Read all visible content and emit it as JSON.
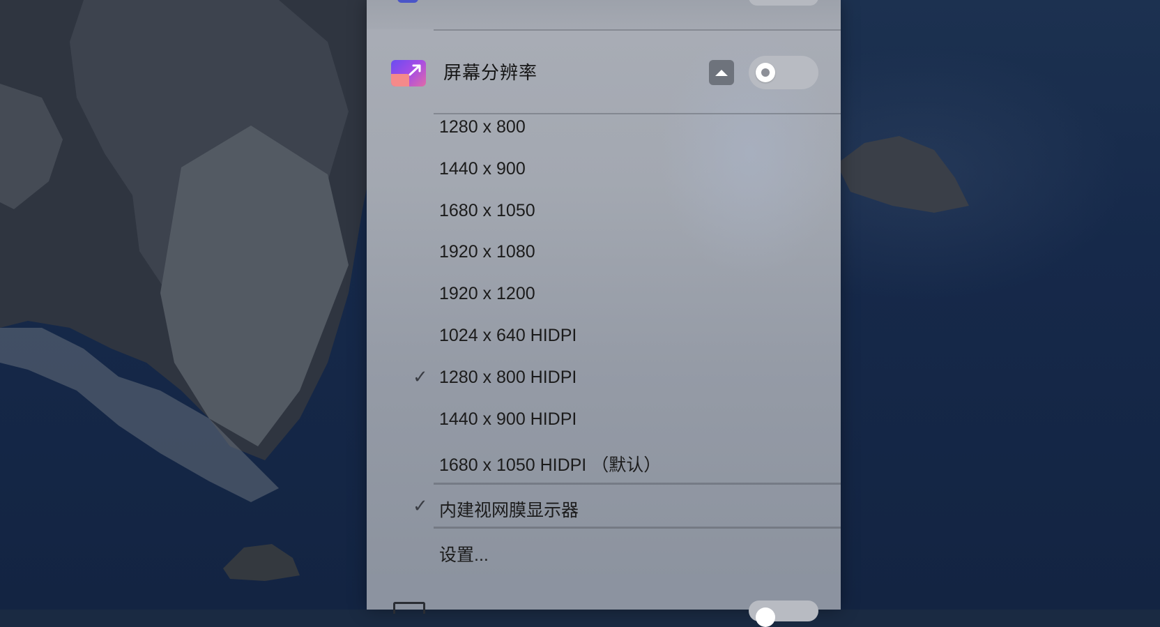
{
  "menu": {
    "header": {
      "title": "屏幕分辨率",
      "icon": "screen-resolution-app-icon",
      "collapse_icon": "chevron-up-icon",
      "toggle_state": "off"
    },
    "resolutions": [
      {
        "label": "1280 x 800",
        "checked": false
      },
      {
        "label": "1440 x 900",
        "checked": false
      },
      {
        "label": "1680 x 1050",
        "checked": false
      },
      {
        "label": "1920 x 1080",
        "checked": false
      },
      {
        "label": "1920 x 1200",
        "checked": false
      },
      {
        "label": "1024 x 640 HIDPI",
        "checked": false
      },
      {
        "label": "1280 x 800 HIDPI",
        "checked": true
      },
      {
        "label": "1440 x 900 HIDPI",
        "checked": false
      },
      {
        "label": "1680 x 1050 HIDPI （默认）",
        "checked": false
      }
    ],
    "display": {
      "label": "内建视网膜显示器",
      "checked": true
    },
    "settings_label": "设置...",
    "check_glyph": "✓"
  },
  "colors": {
    "panel": "#a3a8b1",
    "app_icon_accent": "#a44ce6",
    "toggle_bg": "#b8bbc2"
  }
}
